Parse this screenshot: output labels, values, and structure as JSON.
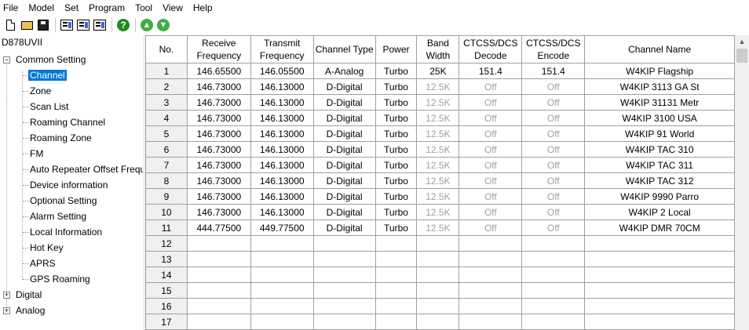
{
  "menu": [
    "File",
    "Model",
    "Set",
    "Program",
    "Tool",
    "View",
    "Help"
  ],
  "toolbar": {
    "help_glyph": "?",
    "up_glyph": "▲",
    "down_glyph": "▼"
  },
  "tree": {
    "root": "D878UVII",
    "common": "Common Setting",
    "common_items": [
      "Channel",
      "Zone",
      "Scan List",
      "Roaming Channel",
      "Roaming Zone",
      "FM",
      "Auto Repeater Offset Frequer",
      "Device information",
      "Optional Setting",
      "Alarm Setting",
      "Local Information",
      "Hot Key",
      "APRS",
      "GPS Roaming"
    ],
    "selected_index": 0,
    "digital": "Digital",
    "analog": "Analog",
    "expander_open": "−",
    "expander_closed": "+"
  },
  "grid": {
    "headers": {
      "no": "No.",
      "rx_1": "Receive",
      "rx_2": "Frequency",
      "tx_1": "Transmit",
      "tx_2": "Frequency",
      "type": "Channel Type",
      "power": "Power",
      "bw_1": "Band",
      "bw_2": "Width",
      "dec_1": "CTCSS/DCS",
      "dec_2": "Decode",
      "enc_1": "CTCSS/DCS",
      "enc_2": "Encode",
      "name": "Channel Name"
    },
    "rows": [
      {
        "no": "1",
        "rx": "146.65500",
        "tx": "146.05500",
        "type": "A-Analog",
        "power": "Turbo",
        "bw": "25K",
        "dec": "151.4",
        "enc": "151.4",
        "name": "W4KIP Flagship",
        "dim": false
      },
      {
        "no": "2",
        "rx": "146.73000",
        "tx": "146.13000",
        "type": "D-Digital",
        "power": "Turbo",
        "bw": "12.5K",
        "dec": "Off",
        "enc": "Off",
        "name": "W4KIP 3113 GA St",
        "dim": true
      },
      {
        "no": "3",
        "rx": "146.73000",
        "tx": "146.13000",
        "type": "D-Digital",
        "power": "Turbo",
        "bw": "12.5K",
        "dec": "Off",
        "enc": "Off",
        "name": "W4KIP 31131 Metr",
        "dim": true
      },
      {
        "no": "4",
        "rx": "146.73000",
        "tx": "146.13000",
        "type": "D-Digital",
        "power": "Turbo",
        "bw": "12.5K",
        "dec": "Off",
        "enc": "Off",
        "name": "W4KIP 3100 USA",
        "dim": true
      },
      {
        "no": "5",
        "rx": "146.73000",
        "tx": "146.13000",
        "type": "D-Digital",
        "power": "Turbo",
        "bw": "12.5K",
        "dec": "Off",
        "enc": "Off",
        "name": "W4KIP 91 World",
        "dim": true
      },
      {
        "no": "6",
        "rx": "146.73000",
        "tx": "146.13000",
        "type": "D-Digital",
        "power": "Turbo",
        "bw": "12.5K",
        "dec": "Off",
        "enc": "Off",
        "name": "W4KIP TAC 310",
        "dim": true
      },
      {
        "no": "7",
        "rx": "146.73000",
        "tx": "146.13000",
        "type": "D-Digital",
        "power": "Turbo",
        "bw": "12.5K",
        "dec": "Off",
        "enc": "Off",
        "name": "W4KIP TAC 311",
        "dim": true
      },
      {
        "no": "8",
        "rx": "146.73000",
        "tx": "146.13000",
        "type": "D-Digital",
        "power": "Turbo",
        "bw": "12.5K",
        "dec": "Off",
        "enc": "Off",
        "name": "W4KIP TAC 312",
        "dim": true
      },
      {
        "no": "9",
        "rx": "146.73000",
        "tx": "146.13000",
        "type": "D-Digital",
        "power": "Turbo",
        "bw": "12.5K",
        "dec": "Off",
        "enc": "Off",
        "name": "W4KIP 9990 Parro",
        "dim": true
      },
      {
        "no": "10",
        "rx": "146.73000",
        "tx": "146.13000",
        "type": "D-Digital",
        "power": "Turbo",
        "bw": "12.5K",
        "dec": "Off",
        "enc": "Off",
        "name": "W4KIP 2 Local",
        "dim": true
      },
      {
        "no": "11",
        "rx": "444.77500",
        "tx": "449.77500",
        "type": "D-Digital",
        "power": "Turbo",
        "bw": "12.5K",
        "dec": "Off",
        "enc": "Off",
        "name": "W4KIP DMR 70CM",
        "dim": true
      },
      {
        "no": "12"
      },
      {
        "no": "13"
      },
      {
        "no": "14"
      },
      {
        "no": "15"
      },
      {
        "no": "16"
      },
      {
        "no": "17"
      }
    ]
  },
  "scrollbar": {
    "up_glyph": "▲"
  }
}
